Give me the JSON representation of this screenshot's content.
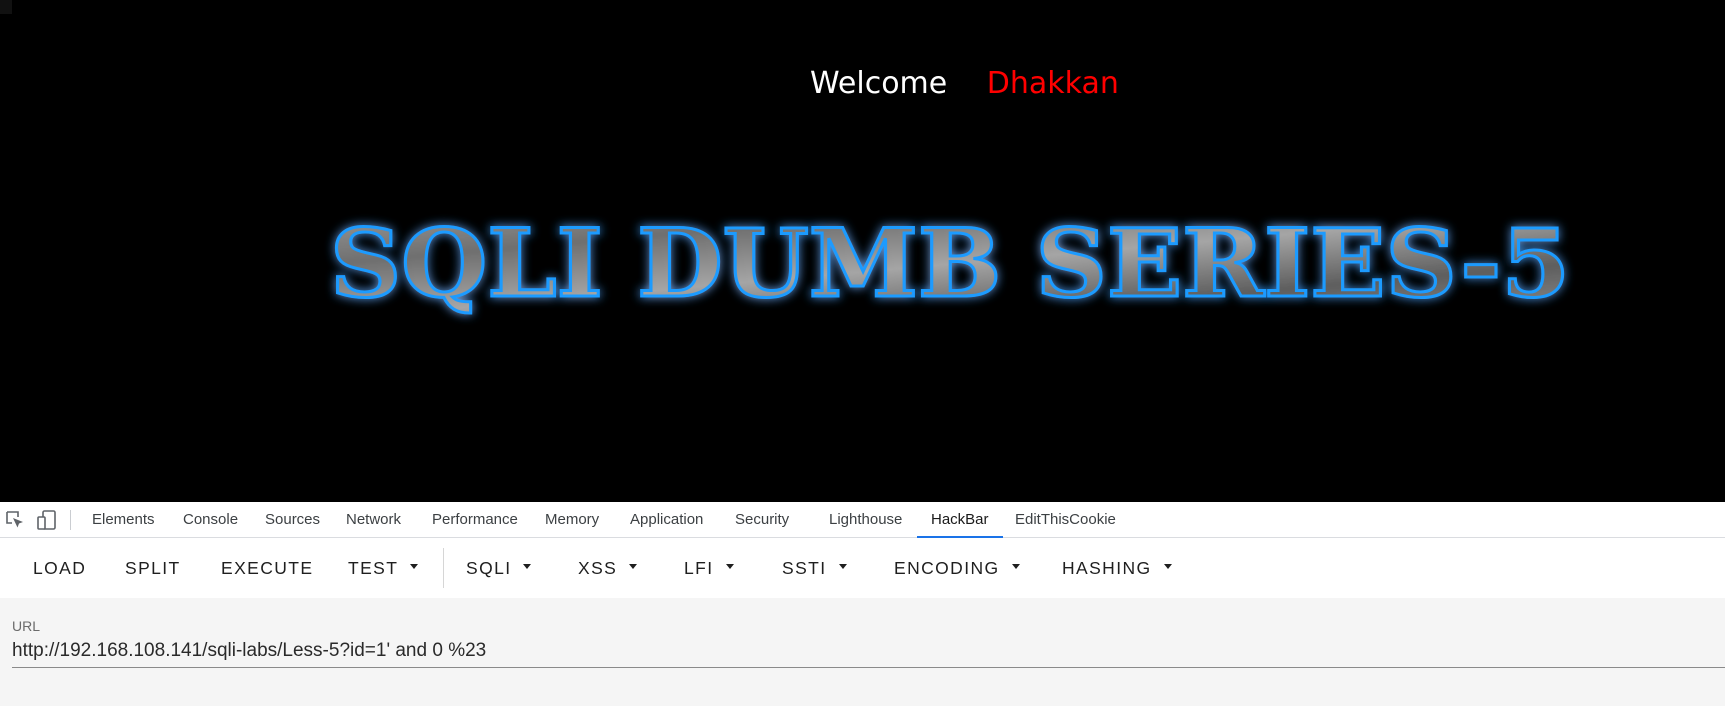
{
  "page": {
    "welcome": "Welcome",
    "user": "Dhakkan",
    "banner_text": "SQLI DUMB SERIES-5"
  },
  "devtools": {
    "tabs": [
      {
        "label": "Elements"
      },
      {
        "label": "Console"
      },
      {
        "label": "Sources"
      },
      {
        "label": "Network"
      },
      {
        "label": "Performance"
      },
      {
        "label": "Memory"
      },
      {
        "label": "Application"
      },
      {
        "label": "Security"
      },
      {
        "label": "Lighthouse"
      },
      {
        "label": "HackBar"
      },
      {
        "label": "EditThisCookie"
      }
    ],
    "active_tab": "HackBar",
    "accent": "#1a73e8"
  },
  "hackbar": {
    "buttons": [
      {
        "label": "LOAD"
      },
      {
        "label": "SPLIT"
      },
      {
        "label": "EXECUTE"
      },
      {
        "label": "TEST"
      },
      {
        "label": "SQLI"
      },
      {
        "label": "XSS"
      },
      {
        "label": "LFI"
      },
      {
        "label": "SSTI"
      },
      {
        "label": "ENCODING"
      },
      {
        "label": "HASHING"
      }
    ],
    "url_label": "URL",
    "url_value": "http://192.168.108.141/sqli-labs/Less-5?id=1' and 0 %23"
  },
  "colors": {
    "welcome": "#ffffff",
    "user": "#ff0000",
    "banner_glow": "#1e9bff"
  }
}
